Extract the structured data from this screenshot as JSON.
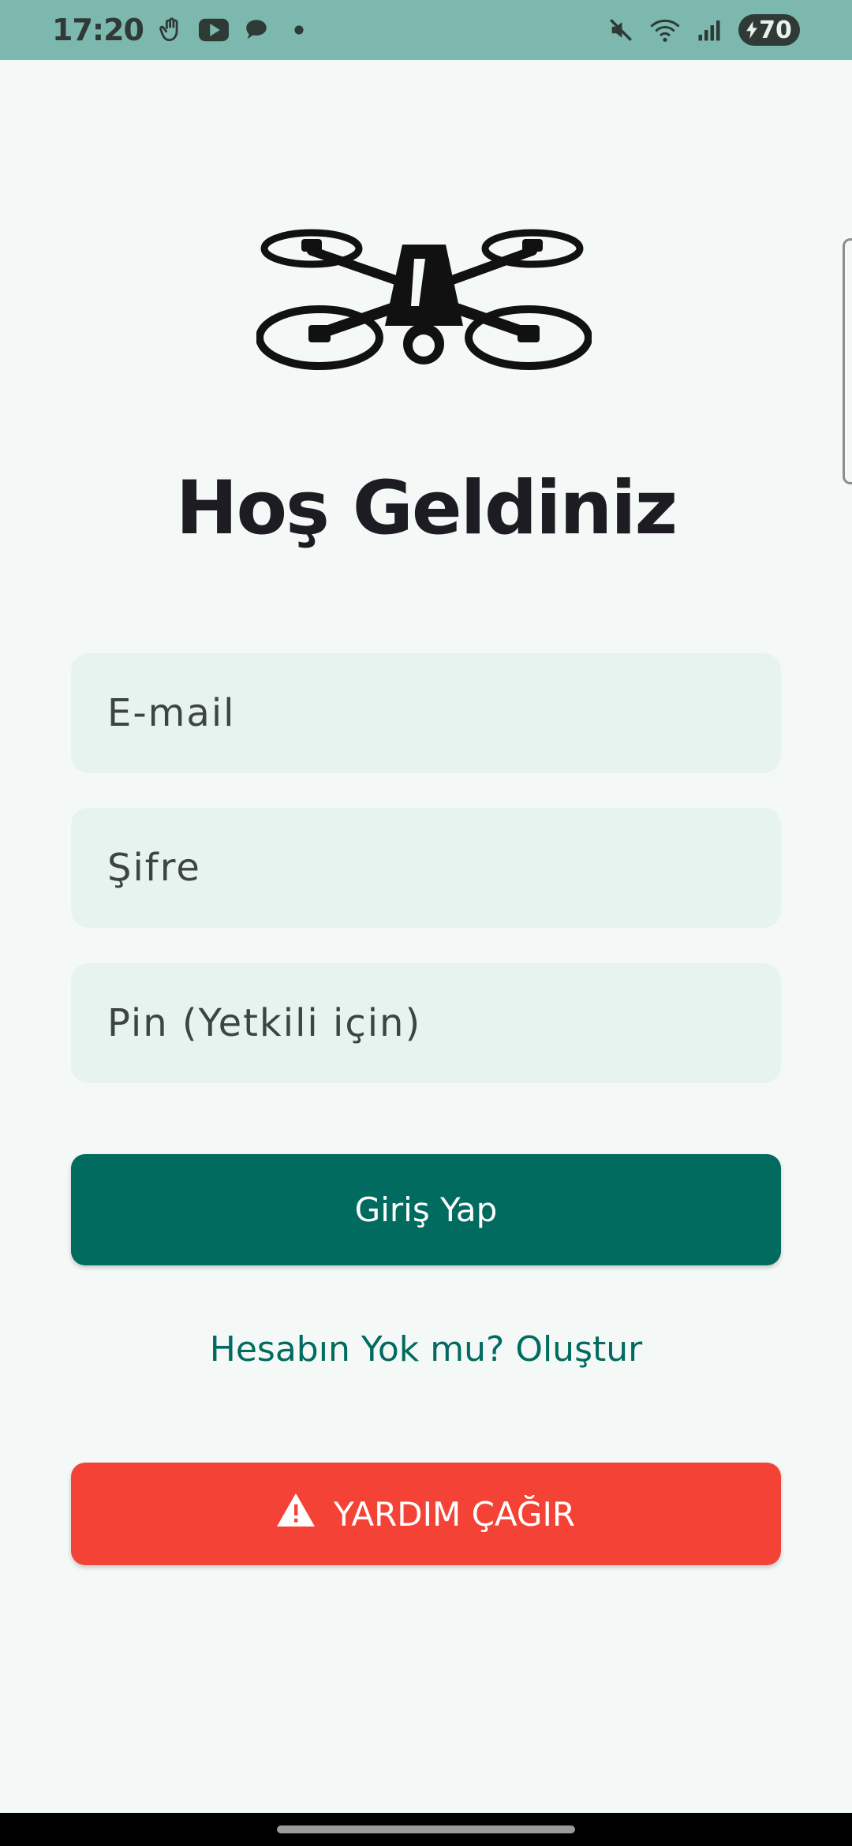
{
  "status_bar": {
    "time": "17:20",
    "battery": "70",
    "left_icons": [
      "hand-icon",
      "youtube-icon",
      "chat-icon",
      "dot-icon"
    ],
    "right_icons": [
      "mute-icon",
      "wifi-icon",
      "signal-icon",
      "battery-icon"
    ],
    "color": "#7cb8ad"
  },
  "logo": {
    "icon": "drone-icon"
  },
  "title": "Hoş Geldiniz",
  "form": {
    "email_placeholder": "E-mail",
    "password_placeholder": "Şifre",
    "pin_placeholder": "Pin (Yetkili için)"
  },
  "login_button": {
    "label": "Giriş Yap",
    "color": "#006b5e"
  },
  "register_link": "Hesabın Yok mu? Oluştur",
  "help_button": {
    "label": "YARDIM ÇAĞIR",
    "icon": "warning-icon",
    "color": "#f44336"
  }
}
